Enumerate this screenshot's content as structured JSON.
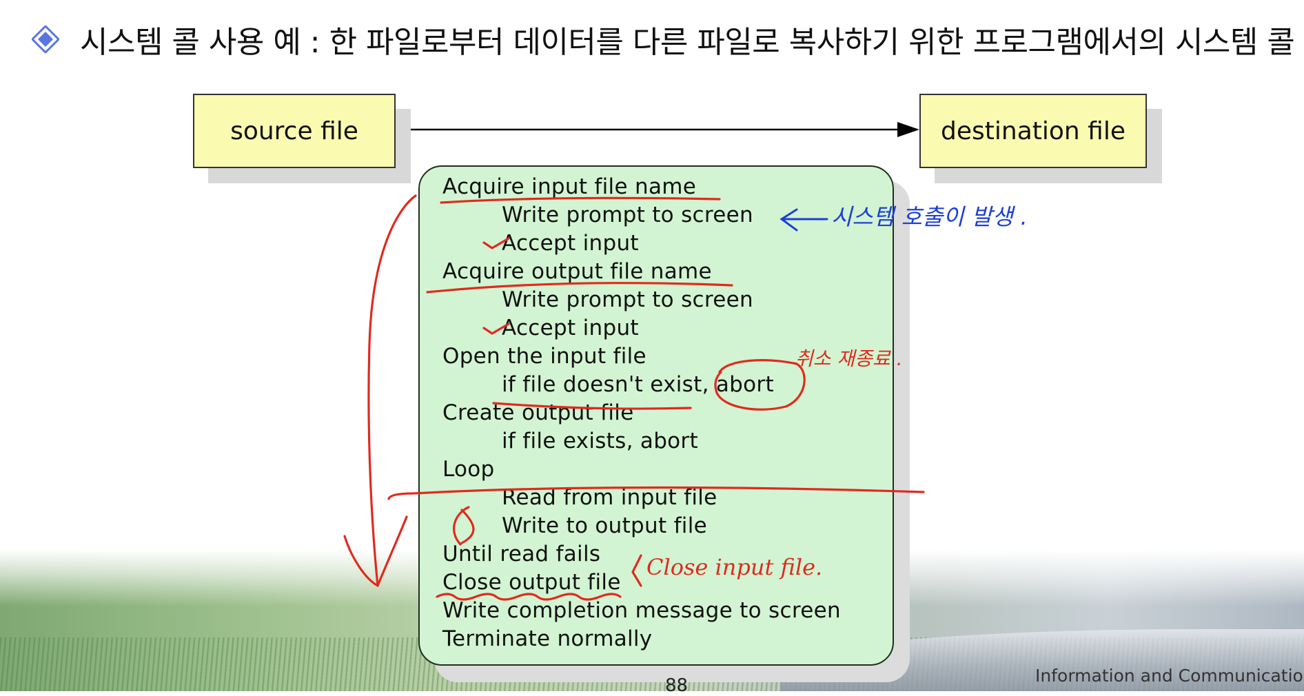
{
  "slide": {
    "title": "시스템 콜 사용 예 : 한 파일로부터 데이터를 다른 파일로 복사하기 위한 프로그램에서의 시스템 콜",
    "page_number": "88",
    "footer": "Information and Communication E"
  },
  "diagram": {
    "source_label": "source file",
    "destination_label": "destination file",
    "steps": [
      {
        "text": "Acquire input file name",
        "indent": false
      },
      {
        "text": "Write prompt to screen",
        "indent": true
      },
      {
        "text": "Accept input",
        "indent": true
      },
      {
        "text": "Acquire output file name",
        "indent": false
      },
      {
        "text": "Write prompt to screen",
        "indent": true
      },
      {
        "text": "Accept input",
        "indent": true
      },
      {
        "text": "Open the input file",
        "indent": false
      },
      {
        "text": "if file doesn't exist, abort",
        "indent": true
      },
      {
        "text": "Create output file",
        "indent": false
      },
      {
        "text": "if file exists, abort",
        "indent": true
      },
      {
        "text": "Loop",
        "indent": false
      },
      {
        "text": "Read from input file",
        "indent": true
      },
      {
        "text": "Write to output file",
        "indent": true
      },
      {
        "text": "Until read fails",
        "indent": false
      },
      {
        "text": "Close output file",
        "indent": false
      },
      {
        "text": "Write completion message to screen",
        "indent": false
      },
      {
        "text": "Terminate normally",
        "indent": false
      }
    ]
  },
  "annotations": {
    "system_call_note": "시스템 호출이 발생 .",
    "abort_note": "취소 재종료 .",
    "close_input_note": "Close input file.",
    "ink_red": "#e02a1e",
    "ink_blue": "#1d3fd6"
  },
  "colors": {
    "file_box": "#fafab0",
    "program_box": "#d2f4d2",
    "bullet": "#5a74e0"
  }
}
